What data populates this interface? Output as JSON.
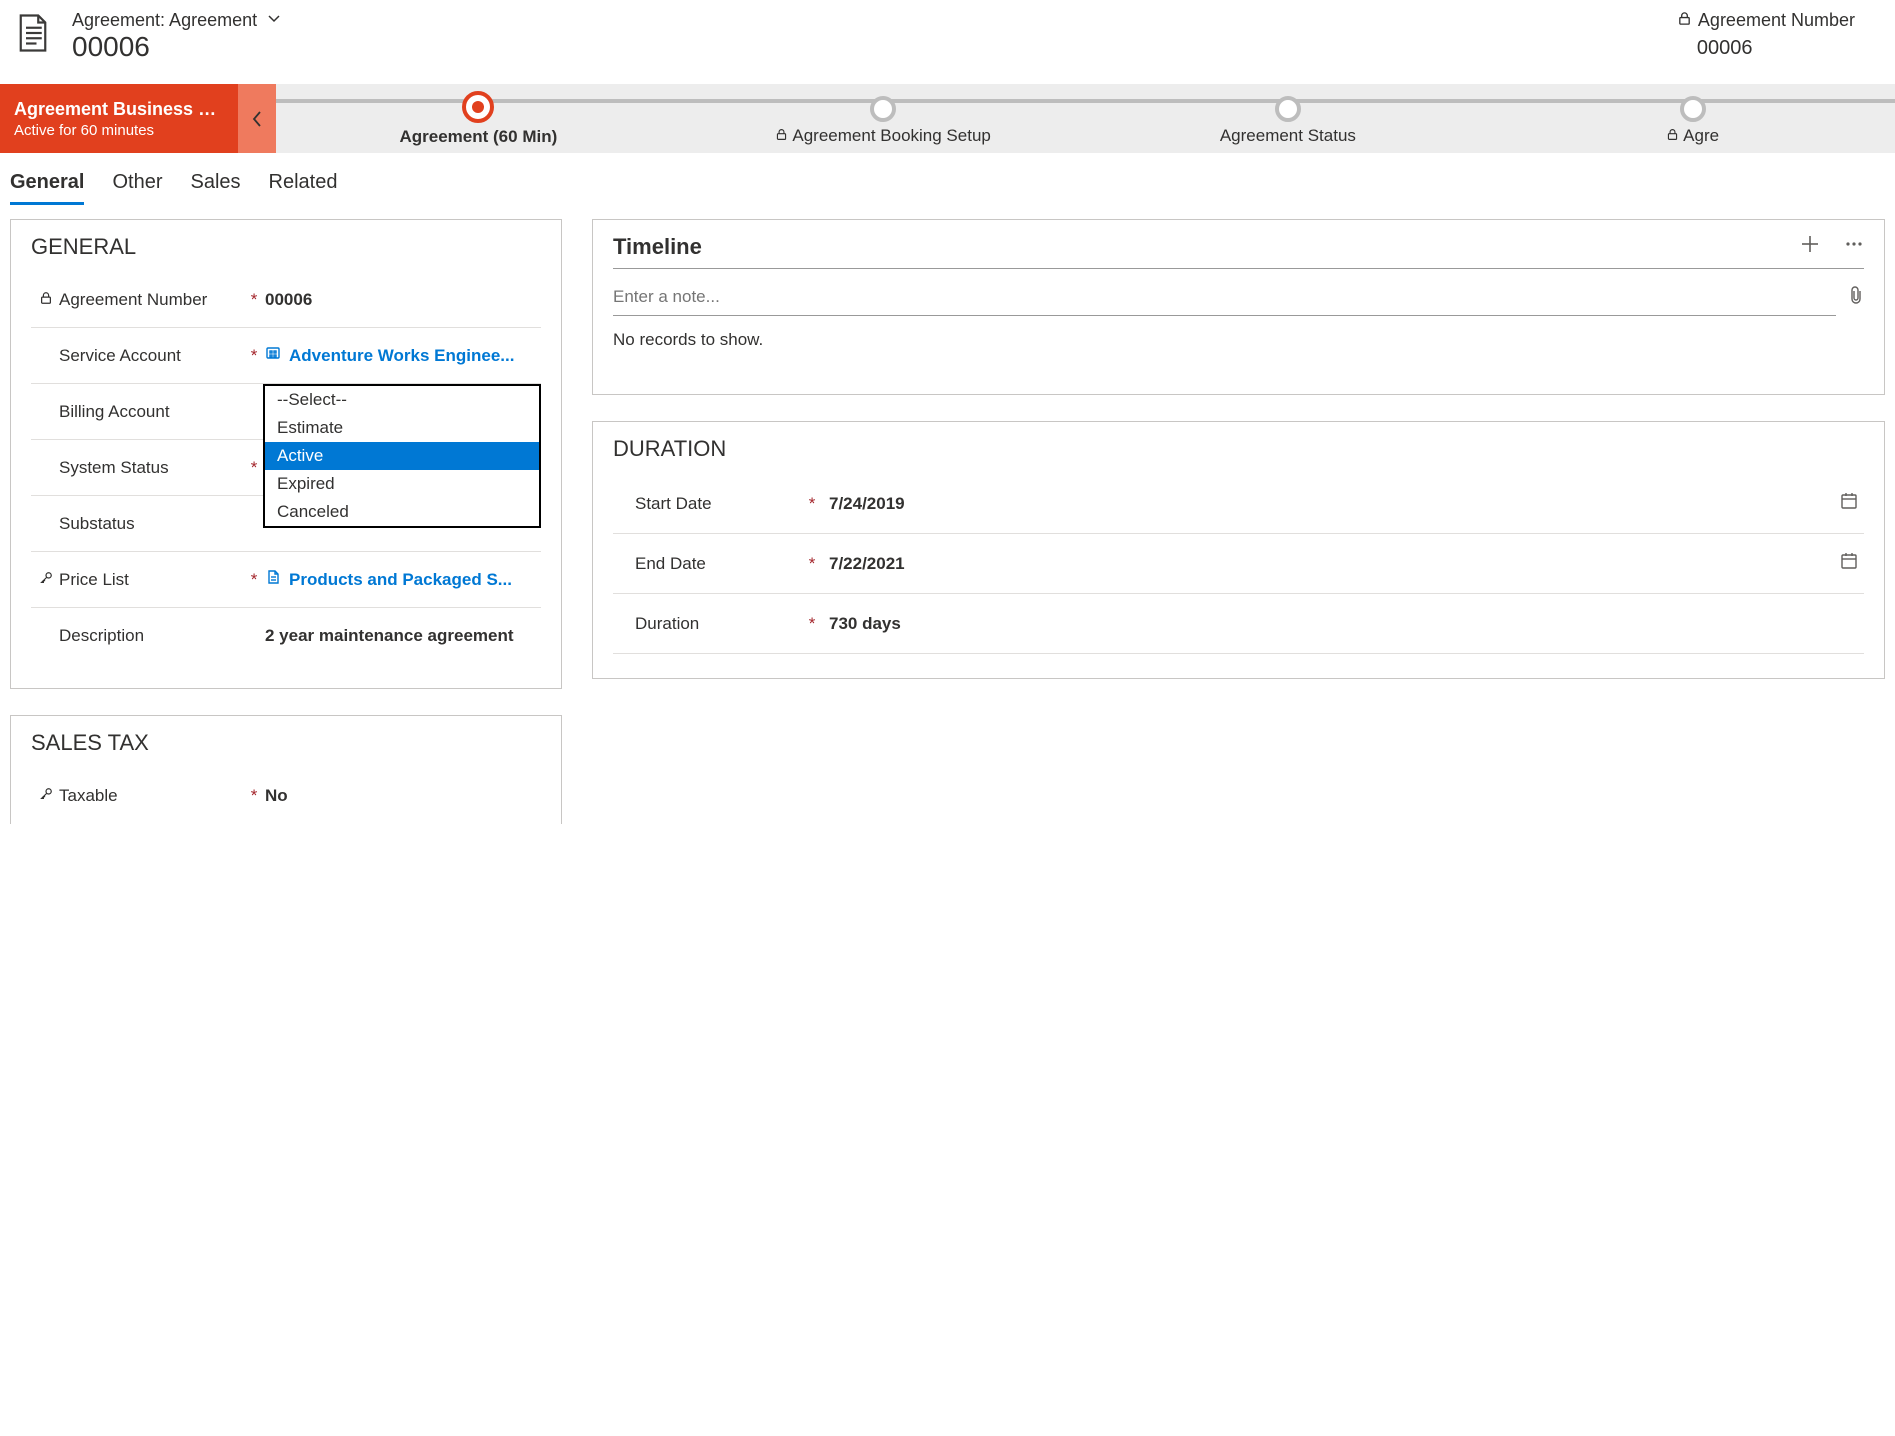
{
  "header": {
    "breadcrumb": "Agreement: Agreement",
    "record_name": "00006",
    "right_label": "Agreement Number",
    "right_value": "00006"
  },
  "process": {
    "badge_title": "Agreement Business Pro...",
    "badge_sub": "Active for 60 minutes",
    "stages": [
      {
        "label": "Agreement  (60 Min)",
        "active": true,
        "locked": false
      },
      {
        "label": "Agreement Booking Setup",
        "active": false,
        "locked": true
      },
      {
        "label": "Agreement Status",
        "active": false,
        "locked": false
      },
      {
        "label": "Agre",
        "active": false,
        "locked": true
      }
    ]
  },
  "tabs": [
    "General",
    "Other",
    "Sales",
    "Related"
  ],
  "active_tab": "General",
  "general": {
    "title": "GENERAL",
    "agreement_number_label": "Agreement Number",
    "agreement_number": "00006",
    "service_account_label": "Service Account",
    "service_account": "Adventure Works Enginee...",
    "billing_account_label": "Billing Account",
    "billing_account": "",
    "system_status_label": "System Status",
    "system_status_options": [
      "--Select--",
      "Estimate",
      "Active",
      "Expired",
      "Canceled"
    ],
    "system_status_selected": "Active",
    "substatus_label": "Substatus",
    "substatus": "",
    "price_list_label": "Price List",
    "price_list": "Products and Packaged S...",
    "description_label": "Description",
    "description": "2 year maintenance agreement"
  },
  "sales_tax": {
    "title": "SALES TAX",
    "taxable_label": "Taxable",
    "taxable": "No"
  },
  "timeline": {
    "title": "Timeline",
    "note_placeholder": "Enter a note...",
    "empty_text": "No records to show."
  },
  "duration": {
    "title": "DURATION",
    "start_date_label": "Start Date",
    "start_date": "7/24/2019",
    "end_date_label": "End Date",
    "end_date": "7/22/2021",
    "duration_label": "Duration",
    "duration": "730 days"
  }
}
